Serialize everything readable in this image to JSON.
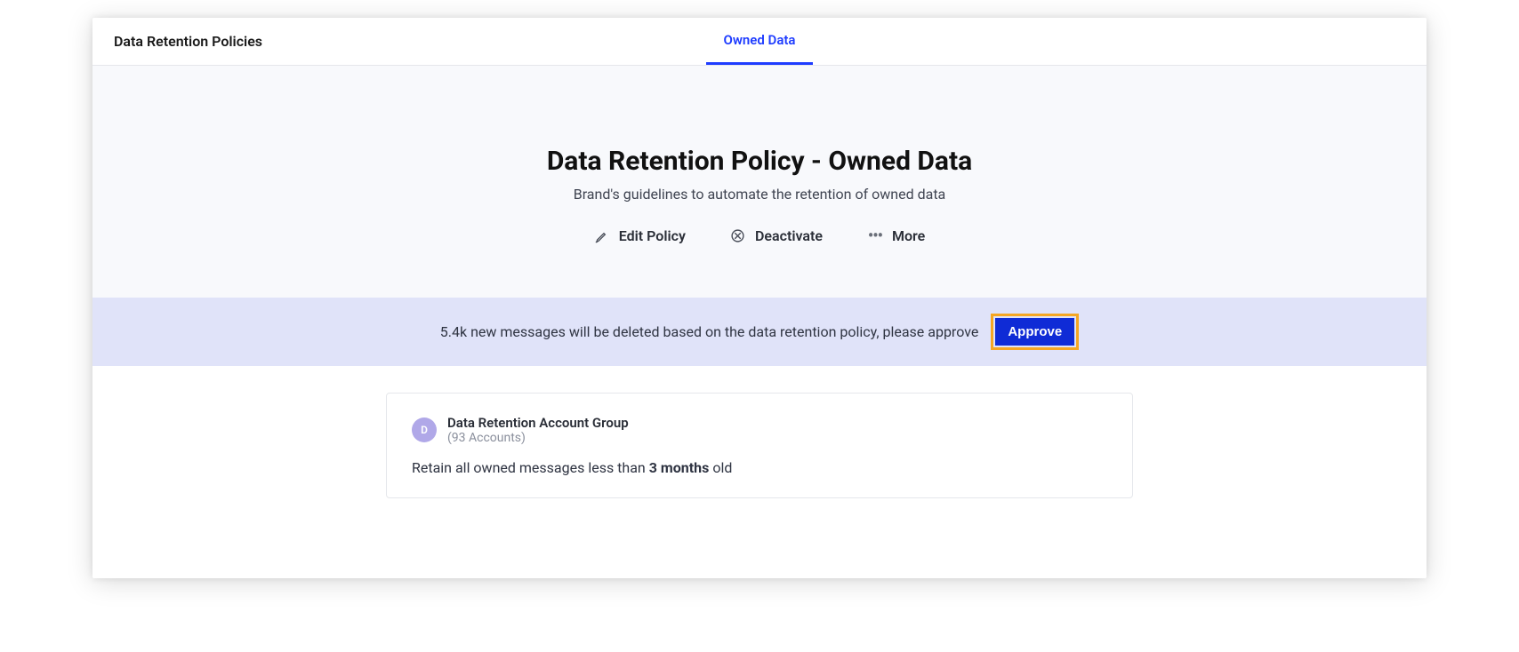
{
  "topbar": {
    "title": "Data Retention Policies"
  },
  "tabs": {
    "owned_data": "Owned Data"
  },
  "hero": {
    "title": "Data Retention Policy - Owned Data",
    "subtitle": "Brand's guidelines to automate the retention of owned data"
  },
  "actions": {
    "edit": "Edit Policy",
    "deactivate": "Deactivate",
    "more": "More"
  },
  "banner": {
    "text": "5.4k new messages will be deleted based on the data retention policy, please approve",
    "approve_label": "Approve"
  },
  "card": {
    "avatar_letter": "D",
    "title": "Data Retention Account Group",
    "subtitle": "(93 Accounts)",
    "body_prefix": "Retain all owned messages less than ",
    "body_strong": "3 months",
    "body_suffix": " old"
  }
}
